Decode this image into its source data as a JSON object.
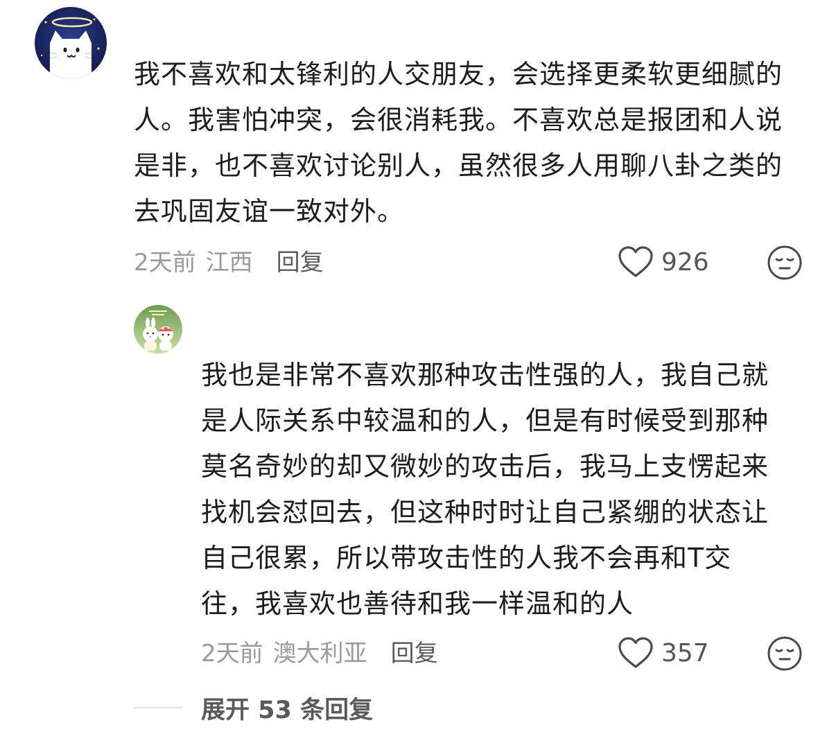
{
  "comment": {
    "avatar_icon": "cat-angel-avatar",
    "text": "我不喜欢和太锋利的人交朋友，会选择更柔软更细腻的人。我害怕冲突，会很消耗我。不喜欢总是报团和人说是非，也不喜欢讨论别人，虽然很多人用聊八卦之类的去巩固友谊一致对外。",
    "time": "2天前",
    "location": "江西",
    "reply_label": "回复",
    "like_count": "926",
    "like_icon": "heart-outline-icon",
    "emoji_icon": "meh-face-icon"
  },
  "reply": {
    "avatar_icon": "bunny-characters-avatar",
    "text": "我也是非常不喜欢那种攻击性强的人，我自己就是人际关系中较温和的人，但是有时候受到那种莫名奇妙的却又微妙的攻击后，我马上支愣起来找机会怼回去，但这种时时让自己紧绷的状态让自己很累，所以带攻击性的人我不会再和T交往，我喜欢也善待和我一样温和的人",
    "time": "2天前",
    "location": "澳大利亚",
    "reply_label": "回复",
    "like_count": "357",
    "like_icon": "heart-outline-icon",
    "emoji_icon": "meh-face-icon"
  },
  "expand": {
    "label": "展开 53 条回复"
  },
  "colors": {
    "text": "#1c1c1c",
    "meta": "#9a9a9a",
    "avatar_main_bg": "#1d2a66",
    "avatar_reply_bg": "#9bc47a"
  }
}
